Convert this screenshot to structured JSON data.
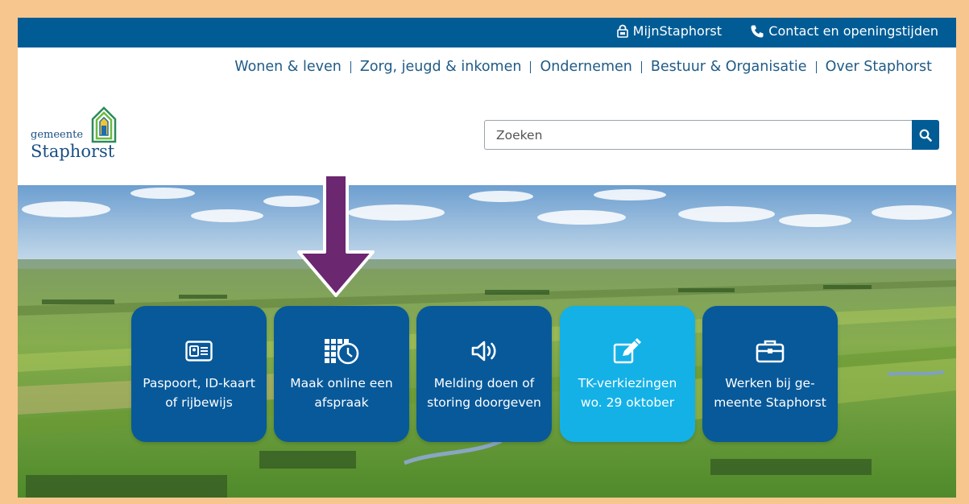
{
  "topbar": {
    "mijn_label": "MijnStaphorst",
    "contact_label": "Contact en openingstijden"
  },
  "nav": {
    "items": [
      "Wonen & leven",
      "Zorg, jeugd & inkomen",
      "Ondernemen",
      "Bestuur & Organisatie",
      "Over Staphorst"
    ]
  },
  "logo": {
    "small": "gemeente",
    "big": "Staphorst"
  },
  "search": {
    "placeholder": "Zoeken"
  },
  "tiles": [
    {
      "line1": "Paspoort, ID-kaart",
      "line2": "of rijbewijs",
      "icon": "id-card-icon"
    },
    {
      "line1": "Maak online een",
      "line2": "afspraak",
      "icon": "calendar-clock-icon"
    },
    {
      "line1": "Melding doen of",
      "line2": "storing doorgeven",
      "icon": "speaker-icon"
    },
    {
      "line1": "TK-verkiezingen",
      "line2": "wo. 29 oktober",
      "icon": "pencil-edit-icon"
    },
    {
      "line1": "Werken bij ge-",
      "line2": "meente Staphorst",
      "icon": "briefcase-icon"
    }
  ],
  "colors": {
    "brand_blue": "#015c96",
    "tile_blue": "#07599a",
    "tile_light_blue": "#14b1e7",
    "frame_border": "#f6c68e",
    "arrow_purple": "#6b2770"
  }
}
